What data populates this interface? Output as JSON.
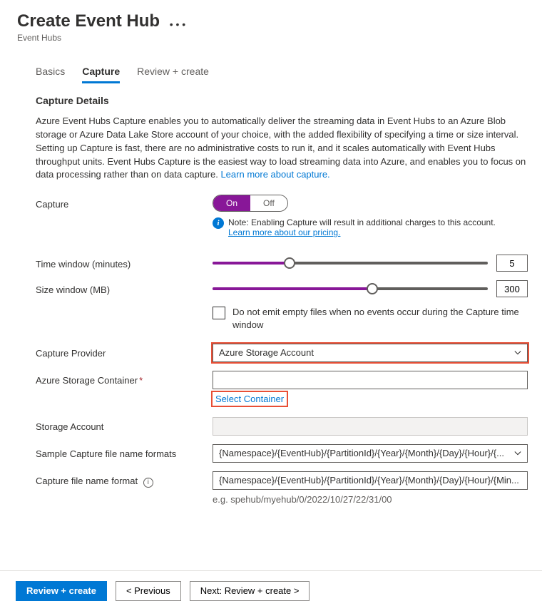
{
  "header": {
    "title": "Create Event Hub",
    "breadcrumb": "Event Hubs"
  },
  "tabs": [
    {
      "label": "Basics"
    },
    {
      "label": "Capture"
    },
    {
      "label": "Review + create"
    }
  ],
  "section": {
    "title": "Capture Details",
    "description": "Azure Event Hubs Capture enables you to automatically deliver the streaming data in Event Hubs to an Azure Blob storage or Azure Data Lake Store account of your choice, with the added flexibility of specifying a time or size interval. Setting up Capture is fast, there are no administrative costs to run it, and it scales automatically with Event Hubs throughput units. Event Hubs Capture is the easiest way to load streaming data into Azure, and enables you to focus on data processing rather than on data capture. ",
    "learn_more": "Learn more about capture."
  },
  "form": {
    "capture_label": "Capture",
    "toggle_on": "On",
    "toggle_off": "Off",
    "note_text": "Note: Enabling Capture will result in additional charges to this account.",
    "note_link": "Learn more about our pricing.",
    "time_window_label": "Time window (minutes)",
    "time_window_value": "5",
    "size_window_label": "Size window (MB)",
    "size_window_value": "300",
    "no_empty_label": "Do not emit empty files when no events occur during the Capture time window",
    "provider_label": "Capture Provider",
    "provider_value": "Azure Storage Account",
    "container_label": "Azure Storage Container",
    "select_container_link": "Select Container",
    "storage_account_label": "Storage Account",
    "sample_formats_label": "Sample Capture file name formats",
    "sample_formats_value": "{Namespace}/{EventHub}/{PartitionId}/{Year}/{Month}/{Day}/{Hour}/{...",
    "format_label": "Capture file name format",
    "format_value": "{Namespace}/{EventHub}/{PartitionId}/{Year}/{Month}/{Day}/{Hour}/{Min...",
    "format_hint": "e.g. spehub/myehub/0/2022/10/27/22/31/00"
  },
  "footer": {
    "review": "Review + create",
    "previous": "< Previous",
    "next": "Next: Review + create >"
  }
}
